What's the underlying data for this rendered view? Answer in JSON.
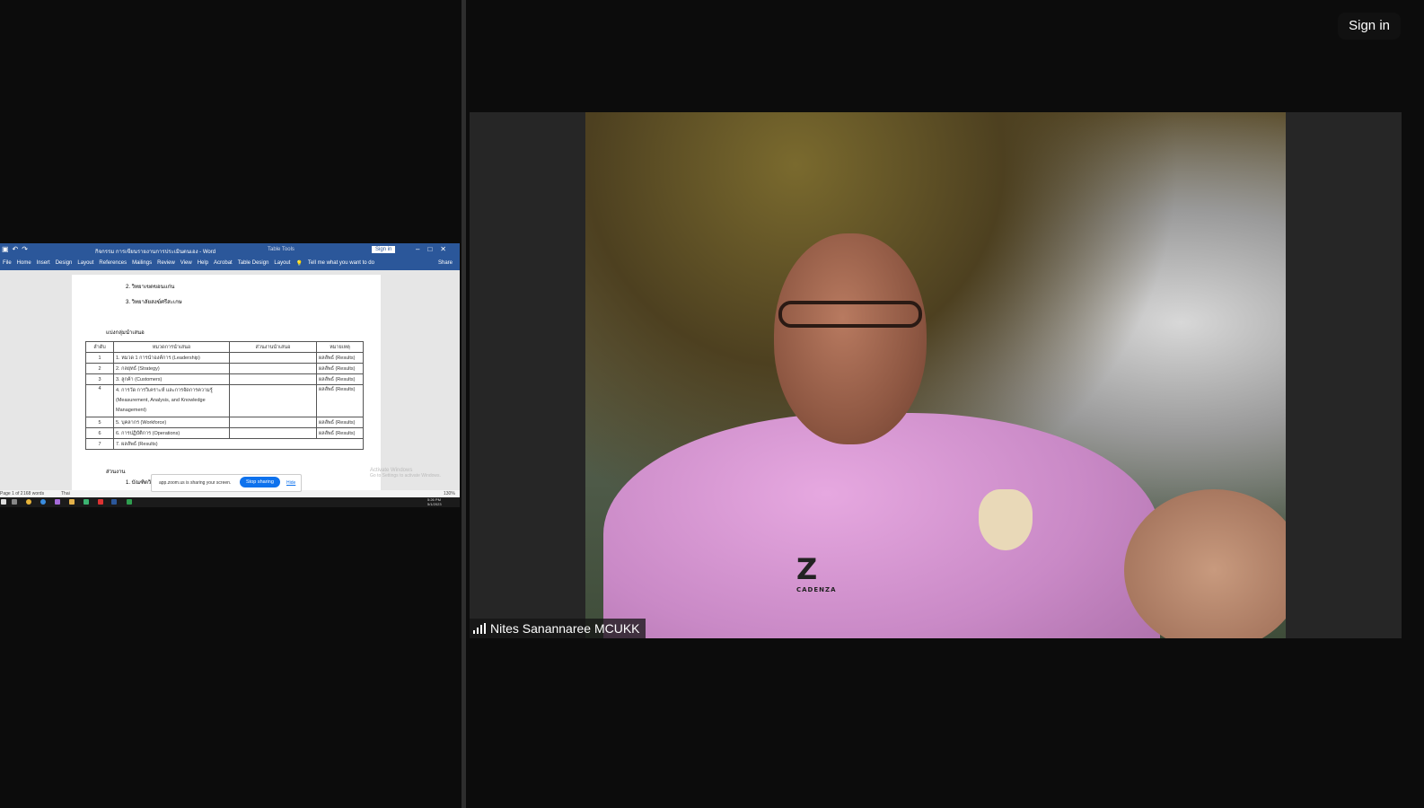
{
  "header": {
    "sign_in_label": "Sign in"
  },
  "shared_screen": {
    "word": {
      "window_title": "กิจกรรม การเขียนรายงานการประเมินตนเอง - Word",
      "table_tools": "Table Tools",
      "sign_in": "Sign in",
      "menu": [
        "File",
        "Home",
        "Insert",
        "Design",
        "Layout",
        "References",
        "Mailings",
        "Review",
        "View",
        "Help",
        "Acrobat",
        "Table Design",
        "Layout"
      ],
      "tell_me": "Tell me what you want to do",
      "share": "Share",
      "doc": {
        "line1": "2. วิทยาเขตขอนแก่น",
        "line2": "3. วิทยาลัยสงฆ์ศรีสะเกษ",
        "group_heading": "แบ่งกลุ่มนำเสนอ",
        "table_headers": [
          "ลำดับ",
          "หมวดการนำเสนอ",
          "ส่วนงานนำเสนอ",
          "หมายเหตุ"
        ],
        "table_rows": [
          [
            "1",
            "1. หมวด 1 การนำองค์การ (Leadership)",
            "",
            "ผลลัพธ์ (Results)"
          ],
          [
            "2",
            "2. กลยุทธ์ (Strategy)",
            "",
            "ผลลัพธ์ (Results)"
          ],
          [
            "3",
            "3. ลูกค้า (Customers)",
            "",
            "ผลลัพธ์ (Results)"
          ],
          [
            "4",
            "4. การวัด การวิเคราะห์ และการจัดการความรู้ (Measurement, Analysis, and Knowledge Management)",
            "",
            "ผลลัพธ์ (Results)"
          ],
          [
            "5",
            "5. บุคลากร (Workforce)",
            "",
            "ผลลัพธ์ (Results)"
          ],
          [
            "6",
            "6. การปฏิบัติการ (Operations)",
            "",
            "ผลลัพธ์ (Results)"
          ],
          [
            "7",
            "7. ผลลัพธ์ (Results)",
            "",
            ""
          ]
        ],
        "section2": "ส่วนงาน",
        "line5": "1. บัณฑิตวิทยาลัย"
      },
      "status": {
        "page": "Page 1 of 2",
        "words": "168 words",
        "lang": "Thai",
        "zoom": "130%"
      },
      "clock": {
        "time": "5:26 PM",
        "date": "5/1/2023"
      }
    },
    "zoom_bar": {
      "message": "app.zoom.us is sharing your screen.",
      "stop_label": "Stop sharing",
      "hide_label": "Hide"
    },
    "activate": {
      "line1": "Activate Windows",
      "line2": "Go to Settings to activate Windows."
    }
  },
  "participant": {
    "name": "Nites Sanannaree MCUKK",
    "shirt_logo": "CADENZA"
  },
  "colors": {
    "zoom_blue": "#0e72ed",
    "word_blue": "#2b579a",
    "shirt_pink": "#d89bd4"
  }
}
